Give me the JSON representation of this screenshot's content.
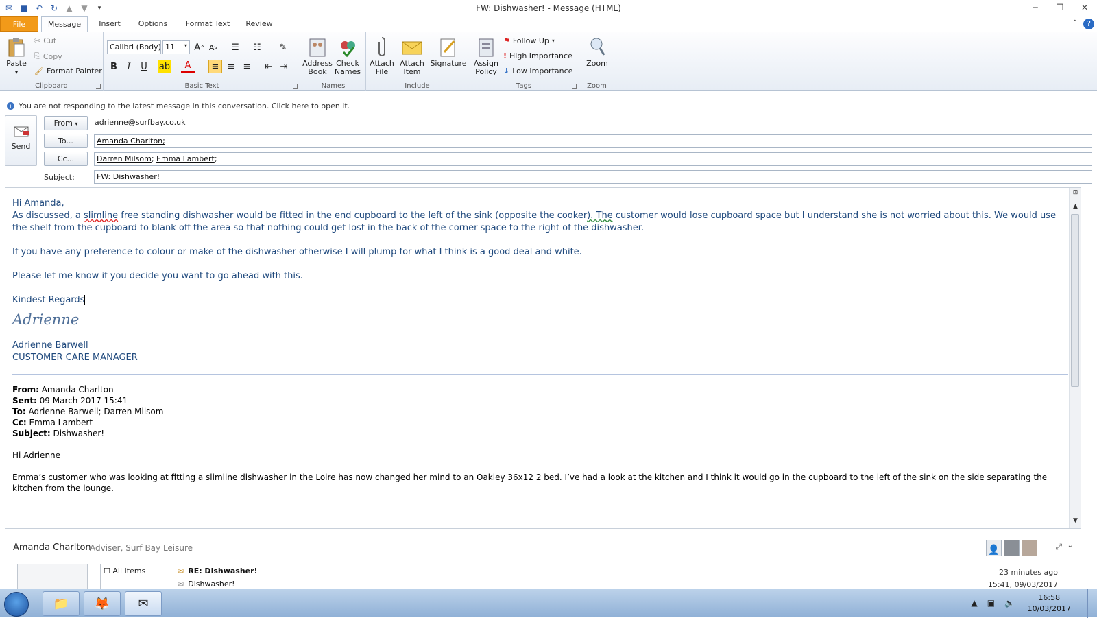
{
  "window": {
    "title": "FW: Dishwasher! - Message (HTML)"
  },
  "tabs": [
    "File",
    "Message",
    "Insert",
    "Options",
    "Format Text",
    "Review"
  ],
  "ribbon": {
    "clipboard": {
      "label": "Clipboard",
      "paste": "Paste",
      "cut": "Cut",
      "copy": "Copy",
      "format_painter": "Format Painter"
    },
    "basic_text": {
      "label": "Basic Text",
      "font": "Calibri (Body)",
      "size": "11"
    },
    "names": {
      "label": "Names",
      "address_book": "Address Book",
      "check_names": "Check Names"
    },
    "include": {
      "label": "Include",
      "attach_file": "Attach File",
      "attach_item": "Attach Item",
      "signature": "Signature"
    },
    "tags": {
      "label": "Tags",
      "assign_policy": "Assign Policy",
      "follow_up": "Follow Up",
      "high": "High Importance",
      "low": "Low Importance"
    },
    "zoom": {
      "label": "Zoom",
      "zoom": "Zoom"
    }
  },
  "infobar": "You are not responding to the latest message in this conversation. Click here to open it.",
  "header": {
    "send": "Send",
    "from_btn": "From",
    "from_value": "adrienne@surfbay.co.uk",
    "to_btn": "To...",
    "to_value": "Amanda Charlton;",
    "cc_btn": "Cc...",
    "cc_1": "Darren Milsom",
    "cc_2": "Emma Lambert",
    "subject_label": "Subject:",
    "subject_value": "FW: Dishwasher!"
  },
  "body": {
    "greeting": "Hi Amanda,",
    "p1_a": "As discussed, a ",
    "p1_err": "slimline",
    "p1_b": " free standing dishwasher would be fitted in the end cupboard to the left of the sink (opposite the cooker",
    "p1_grm": ").  The",
    "p1_c": " customer would lose cupboard space but I understand she is not worried about this.  We would use the shelf from the cupboard to blank off the area so that nothing could get lost in the back of the corner space to the right of the dishwasher.",
    "p2": "If you have any preference to colour or make of the dishwasher otherwise I will plump for what I think is a good deal and white.",
    "p3": "Please let me know if you decide you want to go ahead with this.",
    "closing": "Kindest Regards",
    "signature_script": "Adrienne",
    "sig_name": "Adrienne Barwell",
    "sig_title": "CUSTOMER CARE MANAGER"
  },
  "quoted": {
    "from_label": "From:",
    "from": " Amanda Charlton",
    "sent_label": "Sent:",
    "sent": " 09 March 2017 15:41",
    "to_label": "To:",
    "to": " Adrienne Barwell; Darren Milsom",
    "cc_label": "Cc:",
    "cc": " Emma Lambert",
    "subject_label": "Subject:",
    "subject": " Dishwasher!",
    "greeting": "Hi Adrienne",
    "p1": "Emma’s customer who was looking at fitting a slimline dishwasher in the Loire has now changed her mind to an Oakley 36x12 2 bed.  I’ve had a look at the kitchen and I think it would go in the cupboard to the left of the sink on the side separating the kitchen from the lounge."
  },
  "people": {
    "name": "Amanda Charlton",
    "role": "Adviser, Surf Bay Leisure",
    "filter": "All Items",
    "items": [
      {
        "subject": "RE: Dishwasher!",
        "time": "23 minutes ago"
      },
      {
        "subject": "Dishwasher!",
        "time": "15:41, 09/03/2017"
      }
    ]
  },
  "taskbar": {
    "time": "16:58",
    "date": "10/03/2017"
  },
  "colors": {
    "file_tab": "#f29a19",
    "body_text": "#1f497d",
    "ribbon_bg": "#e7edf5"
  }
}
